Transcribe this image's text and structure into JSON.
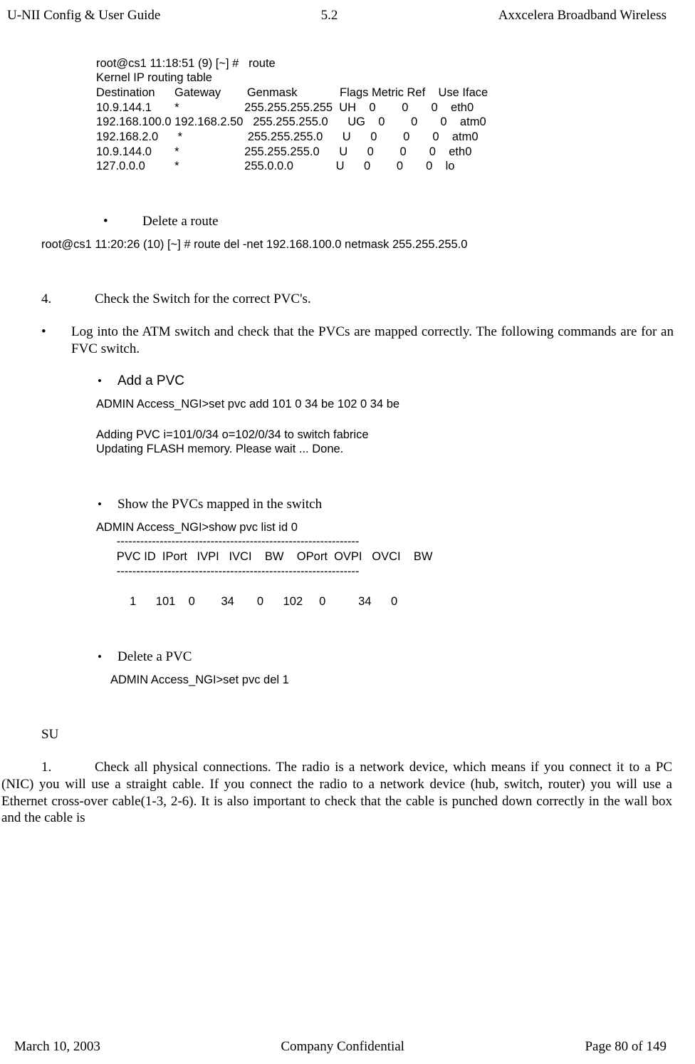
{
  "header": {
    "left": "U-NII Config & User Guide",
    "center": "5.2",
    "right": "Axxcelera Broadband Wireless"
  },
  "footer": {
    "left": "March 10, 2003",
    "center": "Company Confidential",
    "right": "Page 80 of 149"
  },
  "route": {
    "cmd": "root@cs1 11:18:51 (9) [~] #   route",
    "title": "Kernel IP routing table",
    "hdr": "Destination      Gateway        Genmask             Flags Metric Ref    Use Iface",
    "r1": "10.9.144.1       *                    255.255.255.255  UH    0        0       0    eth0",
    "r2": "192.168.100.0 192.168.2.50   255.255.255.0      UG    0        0       0    atm0",
    "r3": "192.168.2.0      *                    255.255.255.0      U      0        0       0    atm0",
    "r4": "10.9.144.0       *                    255.255.255.0      U      0        0       0    eth0",
    "r5": "127.0.0.0         *                    255.0.0.0             U      0        0       0    lo"
  },
  "del_route": {
    "label": "Delete a route",
    "cmd": "root@cs1 11:20:26 (10) [~] #   route   del   -net   192.168.100.0   netmask   255.255.255.0"
  },
  "step4": {
    "num": "4.",
    "text": "Check the Switch for the correct PVC's."
  },
  "log_switch": {
    "text": "Log into the ATM switch and check that the PVCs are mapped correctly. The following commands are for an FVC switch."
  },
  "add_pvc": {
    "label": "Add a PVC",
    "cmd": "ADMIN Access_NGI>set   pvc   add   101   0   34   be   102   0   34   be",
    "out1": "Adding PVC i=101/0/34 o=102/0/34  to switch fabrice",
    "out2": " Updating FLASH memory. Please wait ... Done."
  },
  "show_pvc": {
    "label": "Show the PVCs mapped in the switch",
    "cmd": "ADMIN Access_NGI>show   pvc   list   id   0",
    "sep": "   --------------------------------------------------------------",
    "hdr": "   PVC ID  IPort   IVPI   IVCI    BW    OPort  OVPI   OVCI    BW",
    "row": "       1      101    0        34       0      102     0          34      0"
  },
  "del_pvc": {
    "label": "Delete a PVC",
    "cmd": "ADMIN Access_NGI>set   pvc   del   1"
  },
  "su": {
    "heading": "SU",
    "num": "1.",
    "text": "Check all physical connections. The radio is a network device, which means if you connect it to a PC (NIC) you will use a straight cable. If you  connect the radio to a network device (hub, switch, router) you will use a Ethernet cross-over cable(1-3, 2-6). It is also important to check that the cable is punched down correctly in the wall box and the cable is"
  }
}
